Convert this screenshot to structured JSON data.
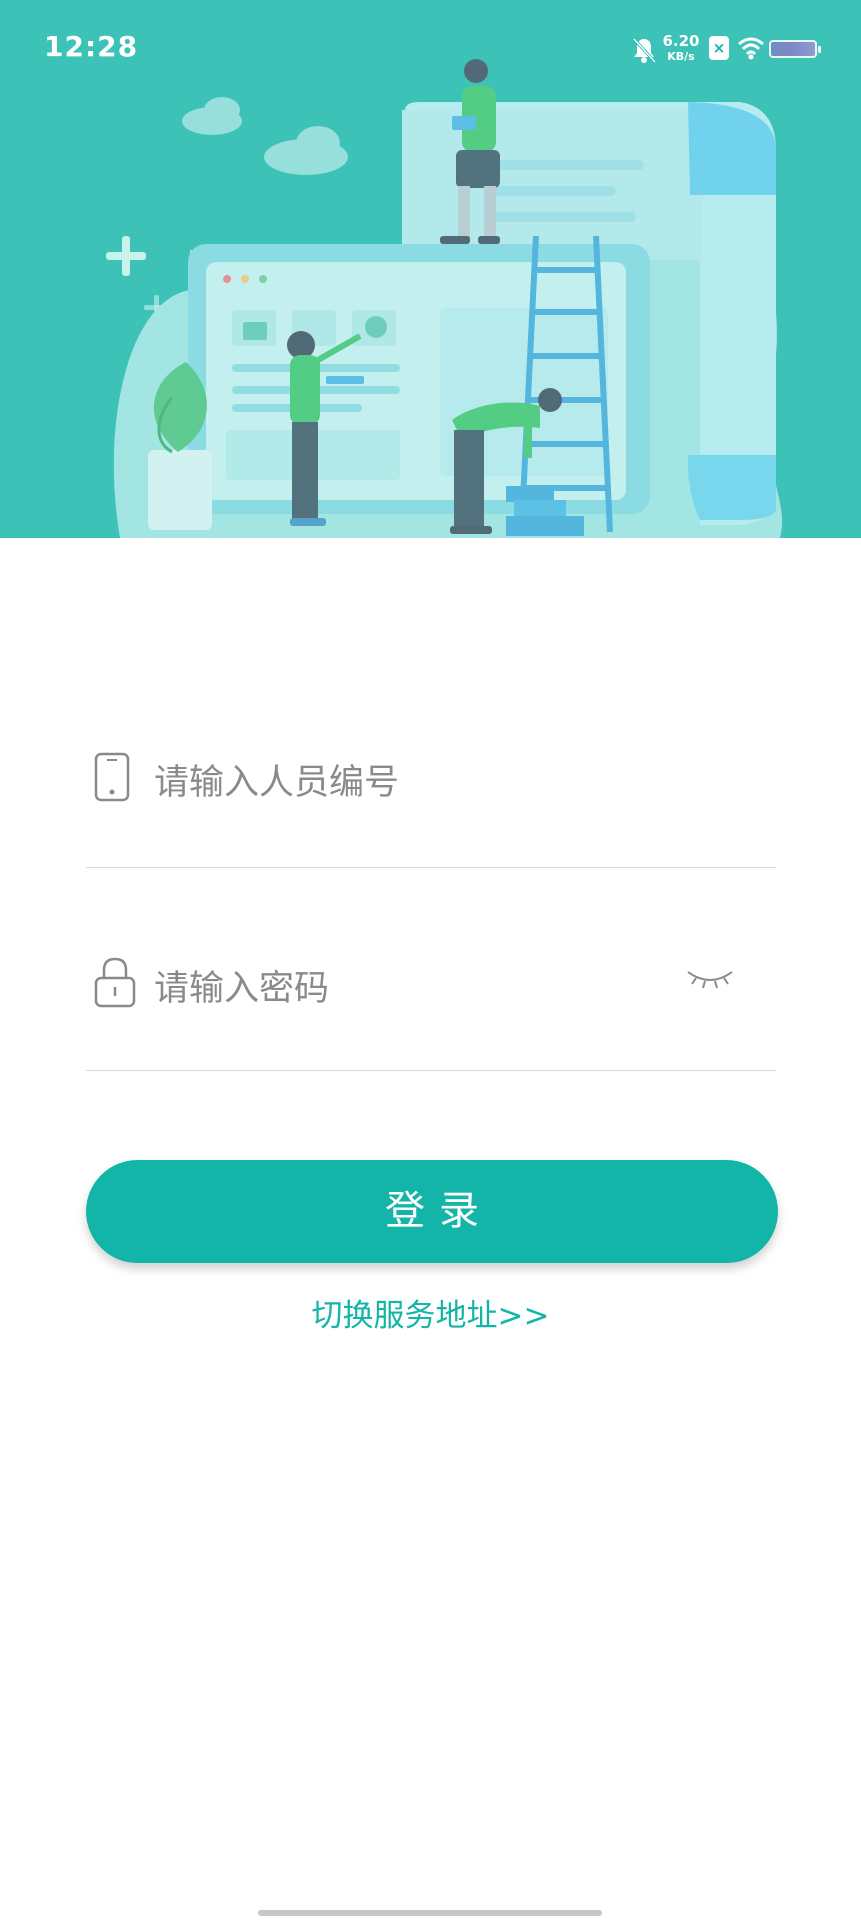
{
  "status_bar": {
    "time": "12:28",
    "net_speed_value": "6.20",
    "net_speed_unit": "KB/s",
    "sim_icon": "sim-disabled-icon",
    "icons": [
      "bell-muted-icon",
      "wifi-icon",
      "battery-icon"
    ]
  },
  "login": {
    "user_placeholder": "请输入人员编号",
    "password_placeholder": "请输入密码",
    "login_button": "登录",
    "switch_server": "切换服务地址>>"
  },
  "colors": {
    "accent": "#13b5a8",
    "placeholder": "#8a8a8a",
    "divider": "#d9d9d9"
  }
}
